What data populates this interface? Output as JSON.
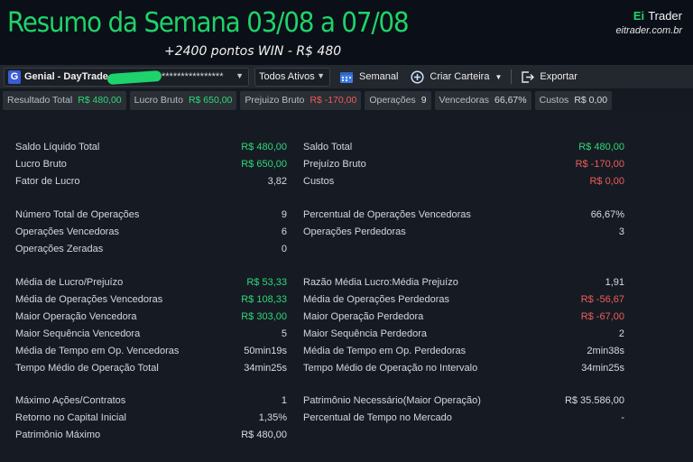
{
  "banner": {
    "title": "Resumo da Semana 03/08 a 07/08",
    "subtitle": "+2400 pontos WIN - R$ 480",
    "brand_ei": "Ei",
    "brand_name": "Trader",
    "brand_url": "eitrader.com.br"
  },
  "toolbar": {
    "account_icon": "G",
    "account_label": "Genial - DayTrade",
    "account_masked": "****************",
    "assets_label": "Todos Ativos",
    "weekly_label": "Semanal",
    "create_label": "Criar Carteira",
    "export_label": "Exportar"
  },
  "chips": [
    {
      "label": "Resultado Total",
      "value": "R$ 480,00",
      "tone": "green"
    },
    {
      "label": "Lucro Bruto",
      "value": "R$ 650,00",
      "tone": "green"
    },
    {
      "label": "Prejuizo Bruto",
      "value": "R$ -170,00",
      "tone": "red"
    },
    {
      "label": "Operações",
      "value": "9",
      "tone": "white"
    },
    {
      "label": "Vencedoras",
      "value": "66,67%",
      "tone": "white"
    },
    {
      "label": "Custos",
      "value": "R$ 0,00",
      "tone": "white"
    }
  ],
  "left": [
    {
      "label": "Saldo Líquido Total",
      "value": "R$ 480,00",
      "tone": "green"
    },
    {
      "label": "Lucro Bruto",
      "value": "R$ 650,00",
      "tone": "green"
    },
    {
      "label": "Fator de Lucro",
      "value": "3,82",
      "tone": "white"
    },
    {
      "label": "Número Total de Operações",
      "value": "9",
      "tone": "white"
    },
    {
      "label": "Operações Vencedoras",
      "value": "6",
      "tone": "white"
    },
    {
      "label": "Operações Zeradas",
      "value": "0",
      "tone": "white"
    },
    {
      "label": "Média de Lucro/Prejuízo",
      "value": "R$ 53,33",
      "tone": "green"
    },
    {
      "label": "Média de Operações Vencedoras",
      "value": "R$ 108,33",
      "tone": "green"
    },
    {
      "label": "Maior Operação Vencedora",
      "value": "R$ 303,00",
      "tone": "green"
    },
    {
      "label": "Maior Sequência Vencedora",
      "value": "5",
      "tone": "white"
    },
    {
      "label": "Média de Tempo em Op. Vencedoras",
      "value": "50min19s",
      "tone": "white"
    },
    {
      "label": "Tempo Médio de Operação Total",
      "value": "34min25s",
      "tone": "white"
    },
    {
      "label": "Máximo Ações/Contratos",
      "value": "1",
      "tone": "white"
    },
    {
      "label": "Retorno no Capital Inicial",
      "value": "1,35%",
      "tone": "white"
    },
    {
      "label": "Patrimônio Máximo",
      "value": "R$ 480,00",
      "tone": "white"
    }
  ],
  "right": [
    {
      "label": "Saldo Total",
      "value": "R$ 480,00",
      "tone": "green"
    },
    {
      "label": "Prejuízo Bruto",
      "value": "R$ -170,00",
      "tone": "red"
    },
    {
      "label": "Custos",
      "value": "R$ 0,00",
      "tone": "red"
    },
    {
      "label": "Percentual de Operações Vencedoras",
      "value": "66,67%",
      "tone": "white"
    },
    {
      "label": "Operações Perdedoras",
      "value": "3",
      "tone": "white"
    },
    {
      "label": "Razão Média Lucro:Média Prejuízo",
      "value": "1,91",
      "tone": "white"
    },
    {
      "label": "Média de Operações Perdedoras",
      "value": "R$ -56,67",
      "tone": "red"
    },
    {
      "label": "Maior Operação Perdedora",
      "value": "R$ -67,00",
      "tone": "red"
    },
    {
      "label": "Maior Sequência Perdedora",
      "value": "2",
      "tone": "white"
    },
    {
      "label": "Média de Tempo em Op. Perdedoras",
      "value": "2min38s",
      "tone": "white"
    },
    {
      "label": "Tempo Médio de Operação no Intervalo",
      "value": "34min25s",
      "tone": "white"
    },
    {
      "label": "Patrimônio Necessário(Maior Operação)",
      "value": "R$ 35.586,00",
      "tone": "white"
    },
    {
      "label": "Percentual de Tempo no Mercado",
      "value": "-",
      "tone": "white"
    }
  ],
  "colors": {
    "green": "#2fd77a",
    "red": "#ef5b5b",
    "banner_green": "#1fd36a"
  }
}
